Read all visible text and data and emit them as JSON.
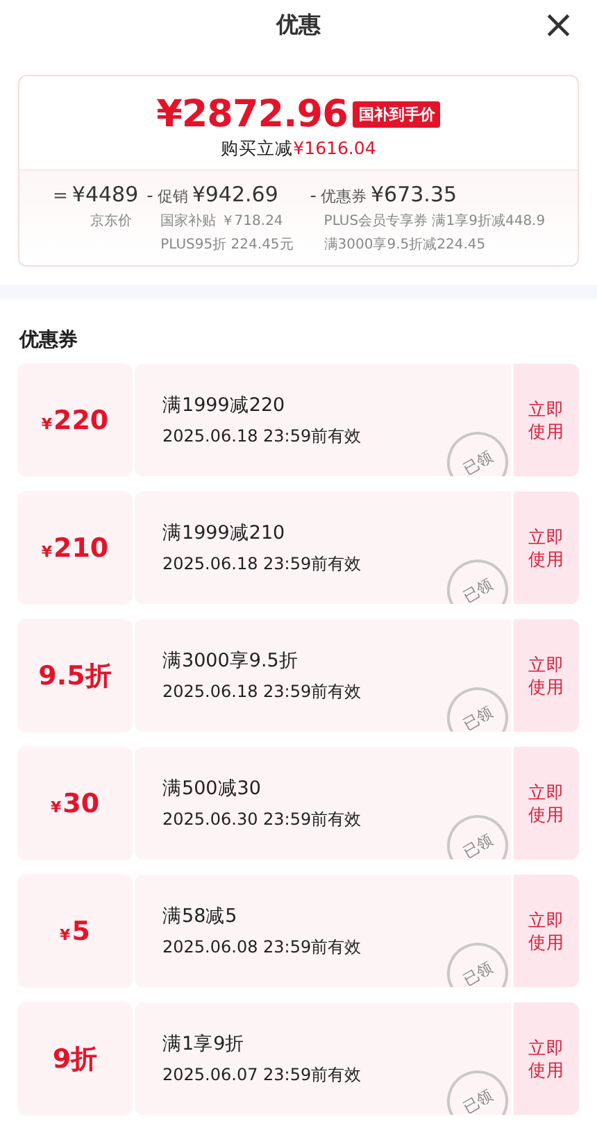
{
  "header": {
    "title": "优惠",
    "close": "×"
  },
  "summary": {
    "price": "¥2872.96",
    "badge": "国补到手价",
    "saving_label": "购买立减",
    "saving_value": "¥1616.04",
    "breakdown": [
      {
        "op": "=",
        "value": "¥4489",
        "notes": [
          "京东价"
        ]
      },
      {
        "op": "-",
        "label": "促销",
        "value": "¥942.69",
        "notes": [
          "国家补贴 ￥718.24",
          "PLUS95折 224.45元"
        ]
      },
      {
        "op": "-",
        "label": "优惠券",
        "value": "¥673.35",
        "notes": [
          "PLUS会员专享券 满1享9折减448.9",
          "满3000享9.5折减224.45"
        ]
      }
    ]
  },
  "section_title": "优惠券",
  "coupons": [
    {
      "kind": "cash",
      "currency": "¥",
      "amount": "220",
      "condition": "满1999减220",
      "validity": "2025.06.18 23:59前有效",
      "stamp": "已领",
      "action": "立即使用"
    },
    {
      "kind": "cash",
      "currency": "¥",
      "amount": "210",
      "condition": "满1999减210",
      "validity": "2025.06.18 23:59前有效",
      "stamp": "已领",
      "action": "立即使用"
    },
    {
      "kind": "discount",
      "amount": "9.5折",
      "condition": "满3000享9.5折",
      "validity": "2025.06.18 23:59前有效",
      "stamp": "已领",
      "action": "立即使用"
    },
    {
      "kind": "cash",
      "currency": "¥",
      "amount": "30",
      "condition": "满500减30",
      "validity": "2025.06.30 23:59前有效",
      "stamp": "已领",
      "action": "立即使用"
    },
    {
      "kind": "cash",
      "currency": "¥",
      "amount": "5",
      "condition": "满58减5",
      "validity": "2025.06.08 23:59前有效",
      "stamp": "已领",
      "action": "立即使用"
    },
    {
      "kind": "discount",
      "amount": "9折",
      "condition": "满1享9折",
      "validity": "2025.06.07 23:59前有效",
      "stamp": "已领",
      "action": "立即使用"
    }
  ]
}
